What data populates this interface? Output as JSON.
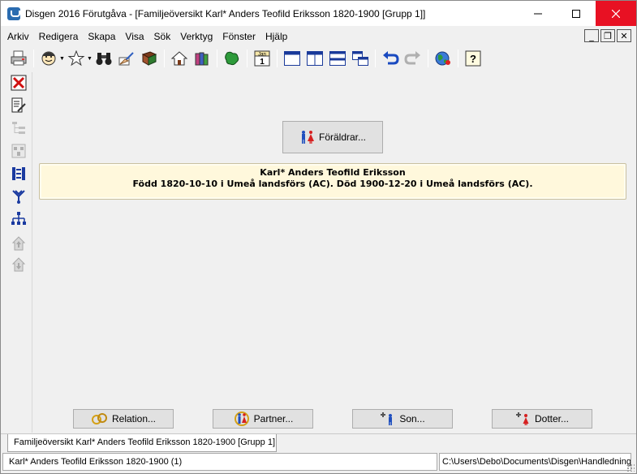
{
  "window": {
    "title": "Disgen 2016 Förutgåva - [Familjeöversikt Karl* Anders Teofild Eriksson 1820-1900 [Grupp 1]]",
    "minimize": "—",
    "maximize": "☐",
    "close": "✕"
  },
  "menu": {
    "items": [
      "Arkiv",
      "Redigera",
      "Skapa",
      "Visa",
      "Sök",
      "Verktyg",
      "Fönster",
      "Hjälp"
    ],
    "mdi_minimize": "_",
    "mdi_restore": "❐",
    "mdi_close": "✕"
  },
  "toolbar": {
    "icons": [
      "printer-icon",
      "person-face-icon",
      "person-star-icon",
      "binoculars-icon",
      "hand-pen-icon",
      "book-icon",
      "home-icon",
      "books-icon",
      "map-icon",
      "calendar-icon",
      "window-single-icon",
      "window-split-vertical-icon",
      "window-split-horizontal-icon",
      "window-cascade-icon",
      "undo-icon",
      "redo-icon",
      "globe-icon",
      "help-icon"
    ],
    "calendar_label": "Jan",
    "calendar_day": "1",
    "help_label": "?"
  },
  "left_toolbar": {
    "icons": [
      "close-x-icon",
      "document-pen-icon",
      "tree-list-icon",
      "report-icon",
      "family-chart-icon",
      "descendants-icon",
      "ancestors-icon",
      "house-up-icon",
      "house-down-icon"
    ]
  },
  "main": {
    "parents_button": "Föräldrar...",
    "person": {
      "name": "Karl* Anders Teofild Eriksson",
      "details": "Född 1820-10-10 i Umeå landsförs (AC). Död 1900-12-20 i Umeå landsförs (AC)."
    }
  },
  "buttons": {
    "relation": "Relation...",
    "partner": "Partner...",
    "son": "Son...",
    "dotter": "Dotter..."
  },
  "tab": {
    "label": "Familjeöversikt Karl* Anders Teofild Eriksson 1820-1900 [Grupp 1]"
  },
  "status": {
    "left": "Karl* Anders Teofild Eriksson 1820-1900 (1)",
    "right": "C:\\Users\\Debo\\Documents\\Disgen\\Handledning"
  },
  "colors": {
    "accent": "#2b6cb0",
    "close_red": "#e81123",
    "card_bg": "#fff8dc",
    "male_blue": "#1f4fbf",
    "female_red": "#d62020"
  }
}
